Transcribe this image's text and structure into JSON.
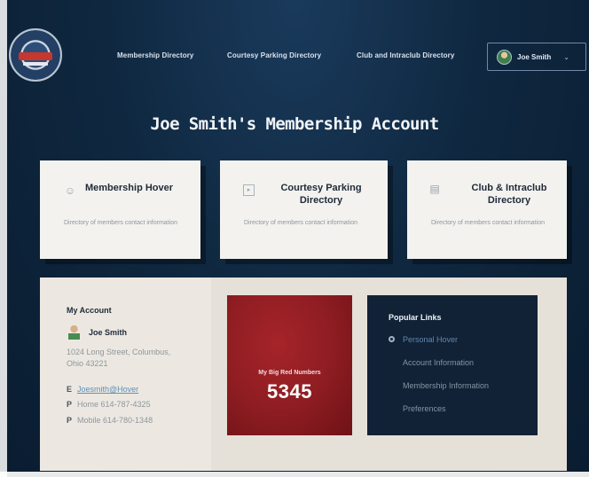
{
  "header": {
    "logo": "club-seal-logo",
    "nav": [
      "Membership Directory",
      "Courtesy Parking Directory",
      "Club and Intraclub Directory"
    ],
    "user": {
      "name": "Joe Smith",
      "caret": "⌄",
      "avatar": "user-avatar"
    }
  },
  "page": {
    "title": "Joe Smith's Membership Account"
  },
  "cards": [
    {
      "icon": "id-card-icon",
      "title": "Membership Hover",
      "desc": "Directory of members contact information"
    },
    {
      "icon": "parking-icon",
      "title": "Courtesy Parking Directory",
      "desc": "Directory of members contact information"
    },
    {
      "icon": "car-icon",
      "title": "Club & Intraclub Directory",
      "desc": "Directory of members contact information"
    }
  ],
  "account": {
    "heading": "My Account",
    "name": "Joe Smith",
    "address": "1024 Long Street, Columbus, Ohio 43221",
    "email_label": "E",
    "email": "Joesmith@Hover",
    "home_label": "P",
    "home": "Home 614-787-4325",
    "mobile_label": "P",
    "mobile": "Mobile 614-780-1348"
  },
  "numbers": {
    "label": "My Big Red Numbers",
    "value": "5345",
    "color": "#9b2026"
  },
  "popular": {
    "heading": "Popular Links",
    "links": [
      "Personal Hover",
      "Account Information",
      "Membership Information",
      "Preferences"
    ]
  }
}
